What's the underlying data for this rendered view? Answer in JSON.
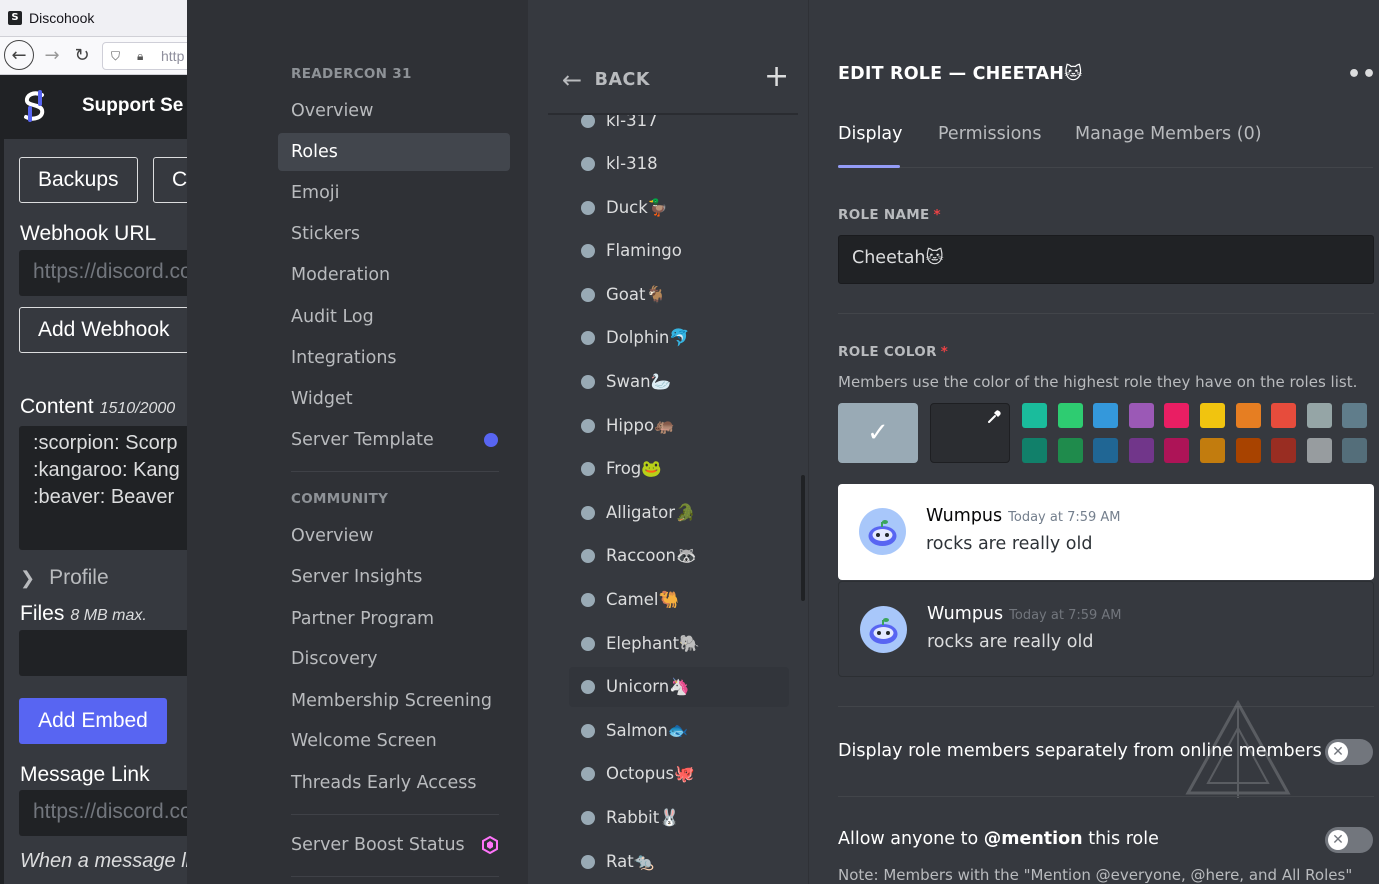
{
  "browser": {
    "tab_title": "Discohook",
    "favicon": "discohook-favicon",
    "url_partial": "http"
  },
  "discohook": {
    "header_title": "Support Se",
    "buttons": {
      "backups": "Backups",
      "clear_partial": "C"
    },
    "webhook_label": "Webhook URL",
    "webhook_placeholder": "https://discord.co",
    "add_webhook": "Add Webhook",
    "content_label": "Content",
    "content_count": "1510/2000",
    "content_lines": [
      ":scorpion:  Scorp",
      ":kangaroo:  Kang",
      ":beaver:  Beaver"
    ],
    "profile_label": "Profile",
    "files_label": "Files",
    "files_sub": "8 MB max.",
    "add_embed": "Add Embed",
    "message_link_label": "Message Link",
    "message_link_placeholder": "https://discord.co",
    "footer_italic": "When a message li"
  },
  "sidebar": {
    "server_section": "READERCON 31",
    "server_items": [
      {
        "label": "Overview"
      },
      {
        "label": "Roles",
        "active": true
      },
      {
        "label": "Emoji"
      },
      {
        "label": "Stickers"
      },
      {
        "label": "Moderation"
      },
      {
        "label": "Audit Log"
      },
      {
        "label": "Integrations"
      },
      {
        "label": "Widget"
      },
      {
        "label": "Server Template"
      }
    ],
    "community_section": "COMMUNITY",
    "community_items": [
      {
        "label": "Overview"
      },
      {
        "label": "Server Insights"
      },
      {
        "label": "Partner Program"
      },
      {
        "label": "Discovery"
      },
      {
        "label": "Membership Screening"
      },
      {
        "label": "Welcome Screen"
      },
      {
        "label": "Threads Early Access"
      }
    ],
    "boost_item": "Server Boost Status",
    "colors": {
      "accent": "#5865f2",
      "boost": "#ff73fa"
    }
  },
  "rolelist": {
    "back_label": "BACK",
    "add_icon": "plus-icon",
    "partial_top": "kl-317",
    "roles": [
      "kl-318",
      "Duck🦆",
      "Flamingo",
      "Goat🐐",
      "Dolphin🐬",
      "Swan🦢",
      "Hippo🦛",
      "Frog🐸",
      "Alligator🐊",
      "Raccoon🦝",
      "Camel🐫",
      "Elephant🐘",
      "Unicorn🦄",
      "Salmon🐟",
      "Octopus🐙",
      "Rabbit🐰",
      "Rat🐀"
    ],
    "hovered_index": 12,
    "role_color": "#99aab5"
  },
  "editor": {
    "title": "EDIT ROLE — CHEETAH🐱",
    "more_icon": "more-icon",
    "tabs": [
      "Display",
      "Permissions",
      "Manage Members (0)"
    ],
    "active_tab": 0,
    "role_name_label": "ROLE NAME",
    "role_name_value": "Cheetah🐱",
    "role_color_label": "ROLE COLOR",
    "role_color_desc": "Members use the color of the highest role they have on the roles list.",
    "default_color": "#99aab5",
    "swatches_top": [
      "#1abc9c",
      "#2ecc71",
      "#3498db",
      "#9b59b6",
      "#e91e63",
      "#f1c40f",
      "#e67e22",
      "#e74c3c",
      "#95a5a6",
      "#607d8b"
    ],
    "swatches_bottom": [
      "#11806a",
      "#1f8b4c",
      "#206694",
      "#71368a",
      "#ad1457",
      "#c27c0e",
      "#a84300",
      "#992d22",
      "#979c9f",
      "#546e7a"
    ],
    "preview": {
      "username": "Wumpus",
      "timestamp": "Today at 7:59 AM",
      "message": "rocks are really old"
    },
    "hoist_label": "Display role members separately from online members",
    "mention_prefix": "Allow anyone to ",
    "mention_bold": "@mention",
    "mention_suffix": " this role",
    "note": "Note: Members with the \"Mention @everyone, @here, and All Roles\""
  }
}
